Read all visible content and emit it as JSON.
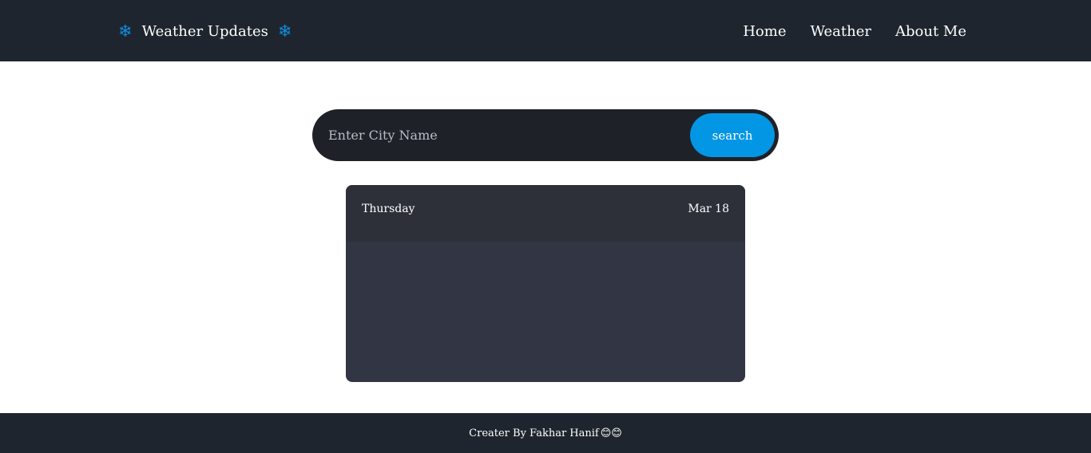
{
  "header": {
    "brand_icon_left": "❄",
    "brand_title": "Weather Updates",
    "brand_icon_right": "❄",
    "nav": [
      {
        "label": "Home"
      },
      {
        "label": "Weather"
      },
      {
        "label": "About Me"
      }
    ]
  },
  "search": {
    "placeholder": "Enter City Name",
    "value": "",
    "button_label": "search"
  },
  "card": {
    "day": "Thursday",
    "date": "Mar 18"
  },
  "footer": {
    "text": "Creater By Fakhar Hanif",
    "emoji": "😊😊"
  },
  "colors": {
    "header_bg": "#1f252e",
    "accent": "#0396e4",
    "search_bg": "#1f2129",
    "card_bg": "#323543",
    "card_header_bg": "#2d3039"
  },
  "icons": {
    "brand_left": "snowflake-icon",
    "brand_right": "snowflake-icon"
  }
}
